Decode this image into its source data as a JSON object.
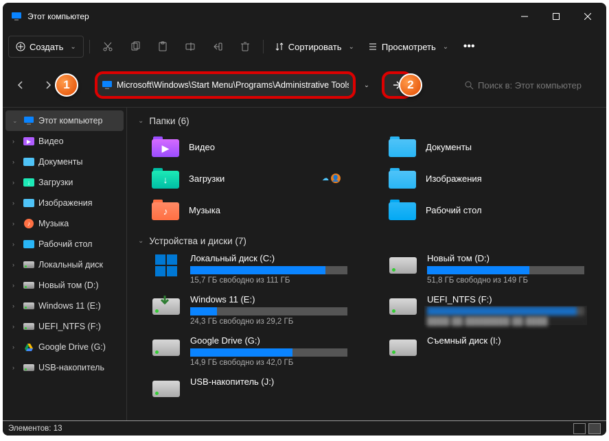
{
  "window": {
    "title": "Этот компьютер"
  },
  "toolbar": {
    "new_label": "Создать",
    "sort_label": "Сортировать",
    "view_label": "Просмотреть"
  },
  "address": {
    "path": "Microsoft\\Windows\\Start Menu\\Programs\\Administrative Tools",
    "callout1": "1",
    "callout2": "2"
  },
  "search": {
    "placeholder": "Поиск в: Этот компьютер"
  },
  "sidebar": [
    {
      "label": "Этот компьютер",
      "icon": "pc",
      "selected": true,
      "exp": "v"
    },
    {
      "label": "Видео",
      "icon": "video",
      "selected": false,
      "exp": ">"
    },
    {
      "label": "Документы",
      "icon": "docs",
      "selected": false,
      "exp": ">"
    },
    {
      "label": "Загрузки",
      "icon": "download",
      "selected": false,
      "exp": ">"
    },
    {
      "label": "Изображения",
      "icon": "images",
      "selected": false,
      "exp": ">"
    },
    {
      "label": "Музыка",
      "icon": "music",
      "selected": false,
      "exp": ">"
    },
    {
      "label": "Рабочий стол",
      "icon": "desktop",
      "selected": false,
      "exp": ">"
    },
    {
      "label": "Локальный диск",
      "icon": "drive",
      "selected": false,
      "exp": ">"
    },
    {
      "label": "Новый том (D:)",
      "icon": "drive",
      "selected": false,
      "exp": ">"
    },
    {
      "label": "Windows 11 (E:)",
      "icon": "drive",
      "selected": false,
      "exp": ">"
    },
    {
      "label": "UEFI_NTFS (F:)",
      "icon": "drive",
      "selected": false,
      "exp": ">"
    },
    {
      "label": "Google Drive (G:)",
      "icon": "gdrive",
      "selected": false,
      "exp": ">"
    },
    {
      "label": "USB-накопитель",
      "icon": "drive",
      "selected": false,
      "exp": ">"
    }
  ],
  "sections": {
    "folders_title": "Папки (6)",
    "folders": [
      {
        "label": "Видео",
        "color1": "#9b4dff",
        "color2": "#d56bff",
        "glyph": "▶"
      },
      {
        "label": "Документы",
        "color1": "#29b6f6",
        "color2": "#4fc3f7",
        "glyph": ""
      },
      {
        "label": "Загрузки",
        "color1": "#00bfa5",
        "color2": "#1de9b6",
        "glyph": "↓",
        "badges": true
      },
      {
        "label": "Изображения",
        "color1": "#29b6f6",
        "color2": "#4fc3f7",
        "glyph": ""
      },
      {
        "label": "Музыка",
        "color1": "#ff7043",
        "color2": "#ff8a65",
        "glyph": "♪"
      },
      {
        "label": "Рабочий стол",
        "color1": "#03a9f4",
        "color2": "#29b6f6",
        "glyph": ""
      }
    ],
    "drives_title": "Устройства и диски (7)",
    "drives": [
      {
        "name": "Локальный диск (C:)",
        "free": "15,7 ГБ свободно из 111 ГБ",
        "pct": 86,
        "icon": "win"
      },
      {
        "name": "Новый том (D:)",
        "free": "51,8 ГБ свободно из 149 ГБ",
        "pct": 65,
        "icon": "drv"
      },
      {
        "name": "Windows 11 (E:)",
        "free": "24,3 ГБ свободно из 29,2 ГБ",
        "pct": 17,
        "icon": "dl"
      },
      {
        "name": "UEFI_NTFS (F:)",
        "free": "",
        "pct": 95,
        "icon": "drv",
        "blur": true
      },
      {
        "name": "Google Drive (G:)",
        "free": "14,9 ГБ свободно из 42,0 ГБ",
        "pct": 65,
        "icon": "drv"
      },
      {
        "name": "Съемный диск (I:)",
        "free": "",
        "pct": 0,
        "icon": "drv",
        "nobar": true
      },
      {
        "name": "USB-накопитель (J:)",
        "free": "",
        "pct": 0,
        "icon": "drv",
        "nobar": true
      }
    ]
  },
  "status": {
    "elements_label": "Элементов:",
    "elements_count": "13"
  }
}
